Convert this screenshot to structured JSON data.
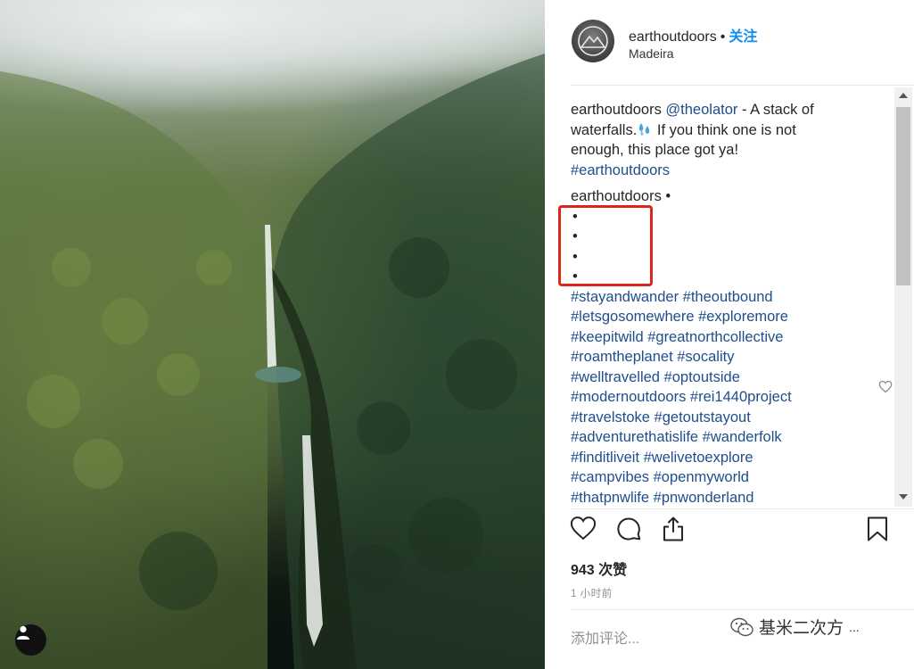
{
  "post": {
    "username": "earthoutdoors",
    "separator": "•",
    "follow_label": "关注",
    "location": "Madeira"
  },
  "caption": {
    "username": "earthoutdoors",
    "mention": "@theolator",
    "text_before": " - A stack of waterfalls.",
    "text_after": " If you think one is not enough, this place got ya!",
    "hashtag": "#earthoutdoors"
  },
  "second_comment": {
    "username": "earthoutdoors",
    "separator": "•",
    "bullets": [
      "•",
      "•",
      "•",
      "•"
    ],
    "hashtag_lines": [
      "#stayandwander #theoutbound",
      "#letsgosomewhere #exploremore",
      "#keepitwild #greatnorthcollective",
      "#roamtheplanet #socality",
      "#welltravelled #optoutside",
      "#modernoutdoors #rei1440project",
      "#travelstoke #getoutstayout",
      "#adventurethatislife #wanderfolk",
      "#finditliveit #welivetoexplore",
      "#campvibes #openmyworld",
      "#thatpnwlife #pnwonderland"
    ]
  },
  "stats": {
    "likes": "943 次赞",
    "time_ago": "1 小时前"
  },
  "comment_box": {
    "placeholder": "添加评论...",
    "more": "..."
  },
  "watermark": {
    "text": "基米二次方"
  },
  "icons": {
    "like": "heart-icon",
    "comment": "comment-bubble-icon",
    "share": "share-icon",
    "save": "bookmark-icon",
    "comment_like": "heart-icon",
    "profile": "user-icon",
    "watermark": "wechat-icon"
  },
  "colors": {
    "follow": "#0f8cf0",
    "hashtag": "#1f4e8c",
    "highlight_box": "#e0241b"
  }
}
